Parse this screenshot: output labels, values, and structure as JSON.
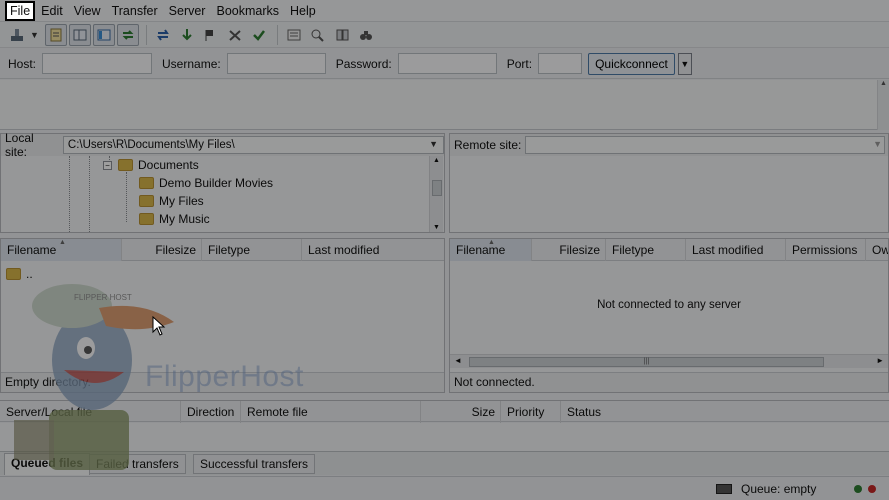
{
  "menubar": {
    "items": [
      "File",
      "Edit",
      "View",
      "Transfer",
      "Server",
      "Bookmarks",
      "Help"
    ]
  },
  "toolbar": {
    "icons": [
      "site-manager-icon",
      "toggle-log-icon",
      "toggle-local-tree-icon",
      "toggle-remote-tree-icon",
      "refresh-icon",
      "process-queue-icon",
      "cancel-icon",
      "disconnect-icon",
      "reconnect-icon",
      "directory-listing-filters-icon",
      "compare-directories-icon",
      "synchronized-browsing-icon",
      "search-remote-icon"
    ]
  },
  "quickconnect": {
    "host_label": "Host:",
    "username_label": "Username:",
    "password_label": "Password:",
    "port_label": "Port:",
    "button_label": "Quickconnect",
    "host_value": "",
    "username_value": "",
    "password_value": "",
    "port_value": ""
  },
  "local": {
    "site_label": "Local site:",
    "path": "C:\\Users\\R\\Documents\\My Files\\",
    "tree": [
      "Documents",
      "Demo Builder Movies",
      "My Files",
      "My Music"
    ],
    "columns": [
      "Filename",
      "Filesize",
      "Filetype",
      "Last modified"
    ],
    "rows": [
      ".."
    ],
    "status": "Empty directory."
  },
  "remote": {
    "site_label": "Remote site:",
    "path": "",
    "columns": [
      "Filename",
      "Filesize",
      "Filetype",
      "Last modified",
      "Permissions",
      "Ow"
    ],
    "empty_message": "Not connected to any server",
    "status": "Not connected."
  },
  "queue": {
    "columns": [
      "Server/Local file",
      "Direction",
      "Remote file",
      "Size",
      "Priority",
      "Status"
    ],
    "tabs": [
      "Queued files",
      "Failed transfers",
      "Successful transfers"
    ],
    "active_tab": "Queued files"
  },
  "statusbar": {
    "queue_text": "Queue: empty",
    "led_colors": [
      "#2e7d32",
      "#c62828"
    ]
  },
  "watermark": {
    "text": "FlipperHost",
    "mascot_cap_text": "FLIPPER HOST"
  }
}
